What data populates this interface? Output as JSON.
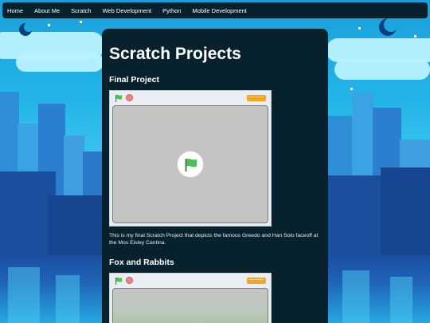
{
  "nav": {
    "items": [
      "Home",
      "About Me",
      "Scratch",
      "Web Development",
      "Python",
      "Mobile Development"
    ]
  },
  "page": {
    "title": "Scratch Projects"
  },
  "projects": [
    {
      "title": "Final Project",
      "description": "This is my final Scratch Project that depicts the famous Greedo and Han Solo faceoff at the Mos Eisley Cantina."
    },
    {
      "title": "Fox and Rabbits"
    }
  ],
  "icons": {
    "flag": "green-flag-icon",
    "stop": "stop-icon",
    "logo": "scratch-logo-icon"
  },
  "colors": {
    "nav_bg": "#07222d",
    "panel_bg": "#07222d",
    "text": "#ffffff",
    "flag_green": "#4cbf56"
  }
}
